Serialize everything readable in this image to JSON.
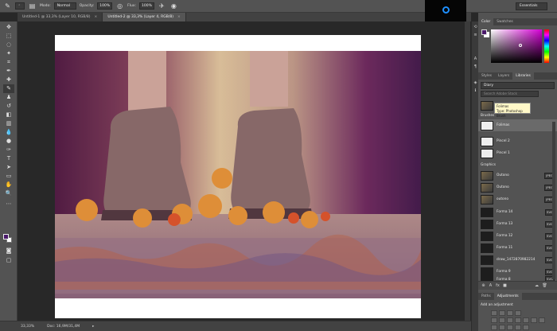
{
  "options_bar": {
    "mode_label": "Modo:",
    "mode_value": "Normal",
    "opacity_label": "Opacity:",
    "opacity_value": "100%",
    "flow_label": "Flux:",
    "flow_value": "100%",
    "workspace": "Essentials"
  },
  "tabs": [
    {
      "title": "Untitled-1 @ 33,3% (Layer 10, RGB/8)",
      "active": false
    },
    {
      "title": "Untitled-2 @ 33,3% (Layer 4, RGB/8)",
      "active": true
    }
  ],
  "tools": [
    "move-icon",
    "marquee-icon",
    "lasso-icon",
    "magic-wand-icon",
    "crop-icon",
    "eyedropper-icon",
    "healing-icon",
    "brush-icon",
    "stamp-icon",
    "history-brush-icon",
    "eraser-icon",
    "gradient-icon",
    "blur-icon",
    "dodge-icon",
    "pen-icon",
    "type-icon",
    "path-select-icon",
    "shape-icon",
    "hand-icon",
    "zoom-icon"
  ],
  "colors": {
    "foreground": "#4b1a6b",
    "background": "#ffffff"
  },
  "status": {
    "zoom": "33,33%",
    "doc": "Doc: 16,9M/31,4M"
  },
  "color_panel": {
    "tabs": [
      "Color",
      "Swatches"
    ]
  },
  "libraries_panel": {
    "tabs": [
      "Styles",
      "Layers",
      "Libraries"
    ],
    "library_name": "Diary",
    "search_placeholder": "Search Adobe Stock",
    "style_name": "ESTILO ALTERADO",
    "brushes_header": "Brushes",
    "tooltip_title": "Folimas",
    "tooltip_type": "Type: Photoshop Brush",
    "brushes": [
      {
        "name": "Folimas",
        "selected": true
      },
      {
        "name": "Pincel 2",
        "selected": false
      },
      {
        "name": "Pincel 1",
        "selected": false
      }
    ],
    "graphics_header": "Graphics",
    "graphics": [
      {
        "name": "Outono",
        "badge": "JPEG",
        "kind": "img"
      },
      {
        "name": "Outono",
        "badge": "JPEG",
        "kind": "img"
      },
      {
        "name": "outono",
        "badge": "JPEG",
        "kind": "img"
      },
      {
        "name": "Forma 14",
        "badge": "SVG",
        "kind": "shape"
      },
      {
        "name": "Forma 13",
        "badge": "SVG",
        "kind": "shape"
      },
      {
        "name": "Forma 12",
        "badge": "SVG",
        "kind": "shape"
      },
      {
        "name": "Forma 11",
        "badge": "SVG",
        "kind": "shape"
      },
      {
        "name": "draw_1472870982214",
        "badge": "SVG",
        "kind": "shape"
      },
      {
        "name": "Forma 9",
        "badge": "SVG",
        "kind": "shape"
      },
      {
        "name": "Forma 8",
        "badge": "SVG",
        "kind": "shape"
      }
    ]
  },
  "adjustments_panel": {
    "tabs": [
      "Paths",
      "Adjustments"
    ],
    "title": "Add an adjustment"
  }
}
